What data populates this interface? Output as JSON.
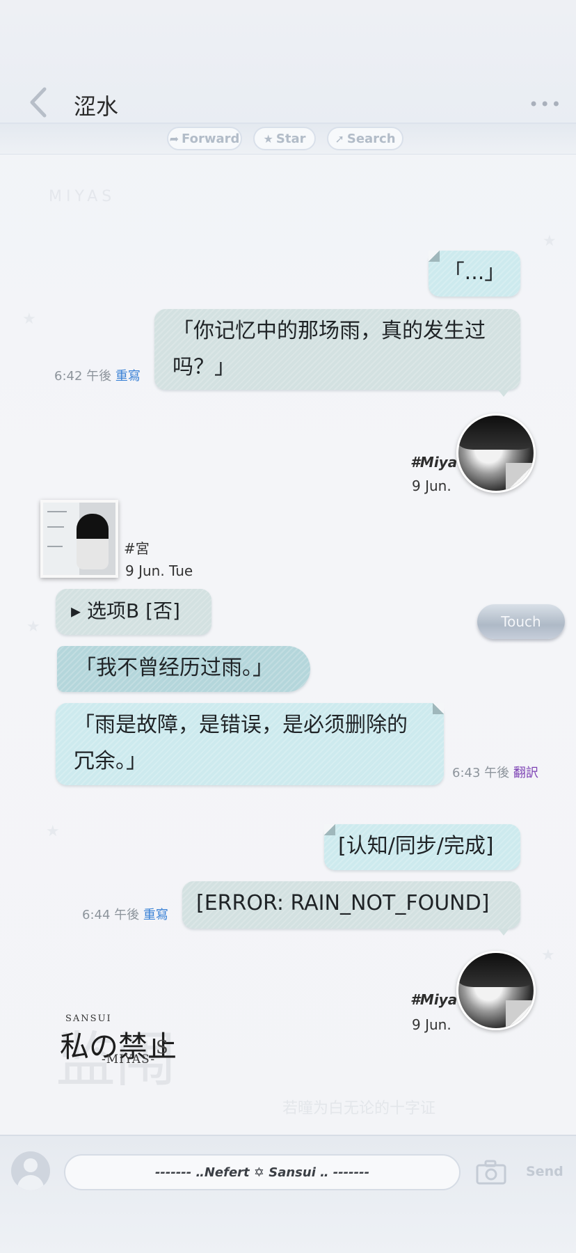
{
  "header": {
    "title": "涩水",
    "more": "•••"
  },
  "toolbar": {
    "forward": "Forward",
    "star": "Star",
    "search": "Search"
  },
  "background_text": {
    "top_faint": "MIYAS",
    "mid_faint": "若曈为白无论的十字证"
  },
  "messages": {
    "m1": "「...」",
    "m2_line1": "「你记忆中的那场雨，真的发生过",
    "m2_line2": "吗？」",
    "m2_time": "6:42 午後",
    "m2_action": "重寫",
    "user1_name": "#Miya",
    "user1_date": "9 Jun.",
    "contact_name": "#宮",
    "contact_date": "9 Jun. Tue",
    "option": "▸ 选项B [否]",
    "touch": "Touch",
    "m4": "「我不曾经历过雨。」",
    "m5_line1": "「雨是故障，是错误，是必须删除的",
    "m5_line2": "冗余。」",
    "m5_time": "6:43 午後",
    "m5_action": "翻訳",
    "m6": "[认知/同步/完成]",
    "m7": "[ERROR: RAIN_NOT_FOUND]",
    "m7_time": "6:44 午後",
    "m7_action": "重寫",
    "user2_name": "#Miya",
    "user2_date": "9 Jun."
  },
  "logo": {
    "sansui": "SANSUI",
    "main": "私の禁止",
    "s": "S",
    "miyas": "-MIYAS-",
    "bg": "监闱"
  },
  "bottom": {
    "input_text": "------- ‥Nefert ✡ Sansui ‥ -------",
    "send": "Send"
  },
  "colors": {
    "bubble_cyan": "#cdeaee",
    "bubble_grey": "#d3e1e1",
    "bubble_teal": "#b4d6db",
    "link_blue": "#3b82d6",
    "link_purple": "#7b3fb3"
  }
}
